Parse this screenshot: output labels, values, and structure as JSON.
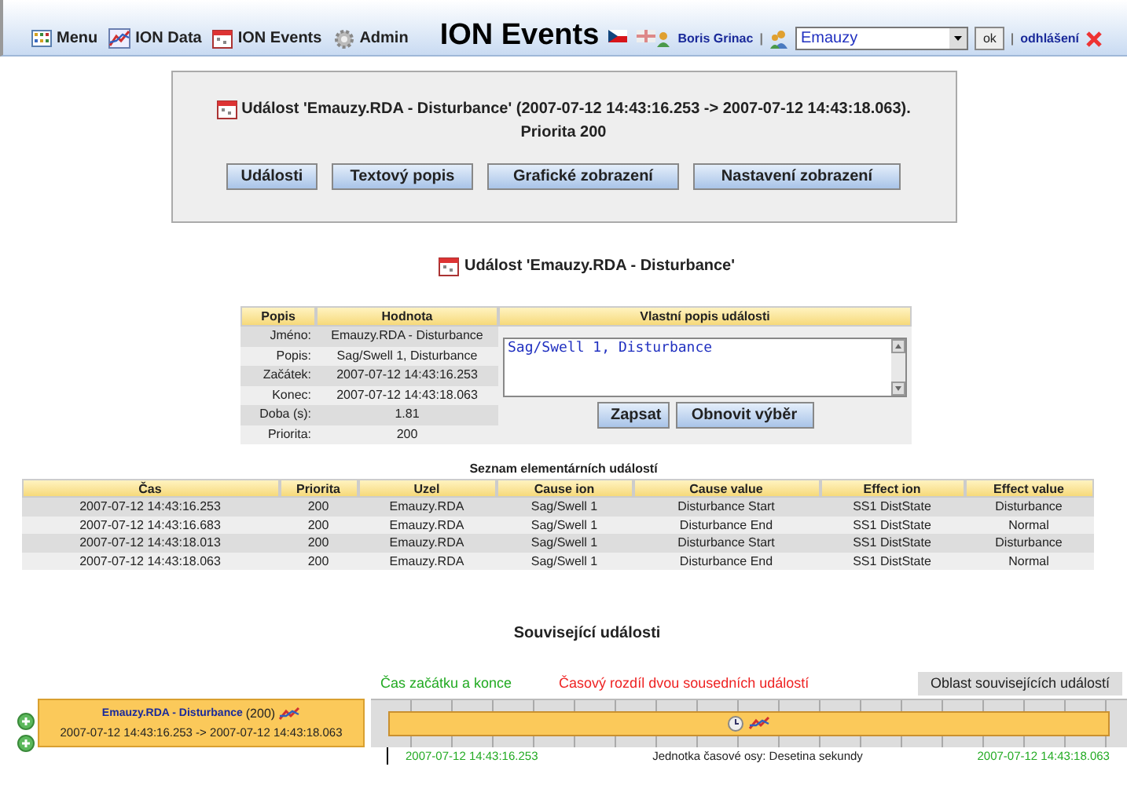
{
  "header": {
    "nav": [
      {
        "label": "Menu"
      },
      {
        "label": "ION Data"
      },
      {
        "label": "ION Events"
      },
      {
        "label": "Admin"
      }
    ],
    "separators": [
      "|",
      "|"
    ],
    "title": "ION Events",
    "user": "Boris Grinac",
    "site": "Emauzy",
    "ok": "ok",
    "logout": "odhlášení"
  },
  "summary": {
    "title": "Událost 'Emauzy.RDA - Disturbance' (2007-07-12 14:43:16.253 -> 2007-07-12 14:43:18.063).",
    "priority": "Priorita 200",
    "buttons": [
      "Události",
      "Textový popis",
      "Grafické zobrazení",
      "Nastavení zobrazení"
    ]
  },
  "detail": {
    "heading": "Událost 'Emauzy.RDA - Disturbance'",
    "columns": [
      "Popis",
      "Hodnota"
    ],
    "rows": [
      {
        "label": "Jméno:",
        "value": "Emauzy.RDA - Disturbance"
      },
      {
        "label": "Popis:",
        "value": "Sag/Swell 1, Disturbance"
      },
      {
        "label": "Začátek:",
        "value": "2007-07-12 14:43:16.253"
      },
      {
        "label": "Konec:",
        "value": "2007-07-12 14:43:18.063"
      },
      {
        "label": "Doba (s):",
        "value": "1.81"
      },
      {
        "label": "Priorita:",
        "value": "200"
      }
    ],
    "description_header": "Vlastní popis události",
    "description": "Sag/Swell 1, Disturbance",
    "buttons": [
      "Zapsat",
      "Obnovit výběr"
    ]
  },
  "elementary": {
    "title": "Seznam elementárních událostí",
    "columns": [
      "Čas",
      "Priorita",
      "Uzel",
      "Cause ion",
      "Cause value",
      "Effect ion",
      "Effect value"
    ],
    "rows": [
      [
        "2007-07-12 14:43:16.253",
        "200",
        "Emauzy.RDA",
        "Sag/Swell 1",
        "Disturbance Start",
        "SS1 DistState",
        "Disturbance"
      ],
      [
        "2007-07-12 14:43:16.683",
        "200",
        "Emauzy.RDA",
        "Sag/Swell 1",
        "Disturbance End",
        "SS1 DistState",
        "Normal"
      ],
      [
        "2007-07-12 14:43:18.013",
        "200",
        "Emauzy.RDA",
        "Sag/Swell 1",
        "Disturbance Start",
        "SS1 DistState",
        "Disturbance"
      ],
      [
        "2007-07-12 14:43:18.063",
        "200",
        "Emauzy.RDA",
        "Sag/Swell 1",
        "Disturbance End",
        "SS1 DistState",
        "Normal"
      ]
    ]
  },
  "related": {
    "title": "Související události",
    "legend": [
      {
        "text": "Čas začátku a konce",
        "kind": "start_end"
      },
      {
        "text": "Časový rozdíl dvou sousedních událostí",
        "kind": "gap"
      },
      {
        "text": "Oblast souvisejících událostí",
        "kind": "area"
      }
    ],
    "event": {
      "name": "Emauzy.RDA - Disturbance",
      "priority": "(200)",
      "range": "2007-07-12 14:43:16.253 -> 2007-07-12 14:43:18.063"
    },
    "axis": {
      "start": "2007-07-12 14:43:16.253",
      "unit": "Jednotka časové osy: Desetina sekundy",
      "end": "2007-07-12 14:43:18.063"
    }
  }
}
